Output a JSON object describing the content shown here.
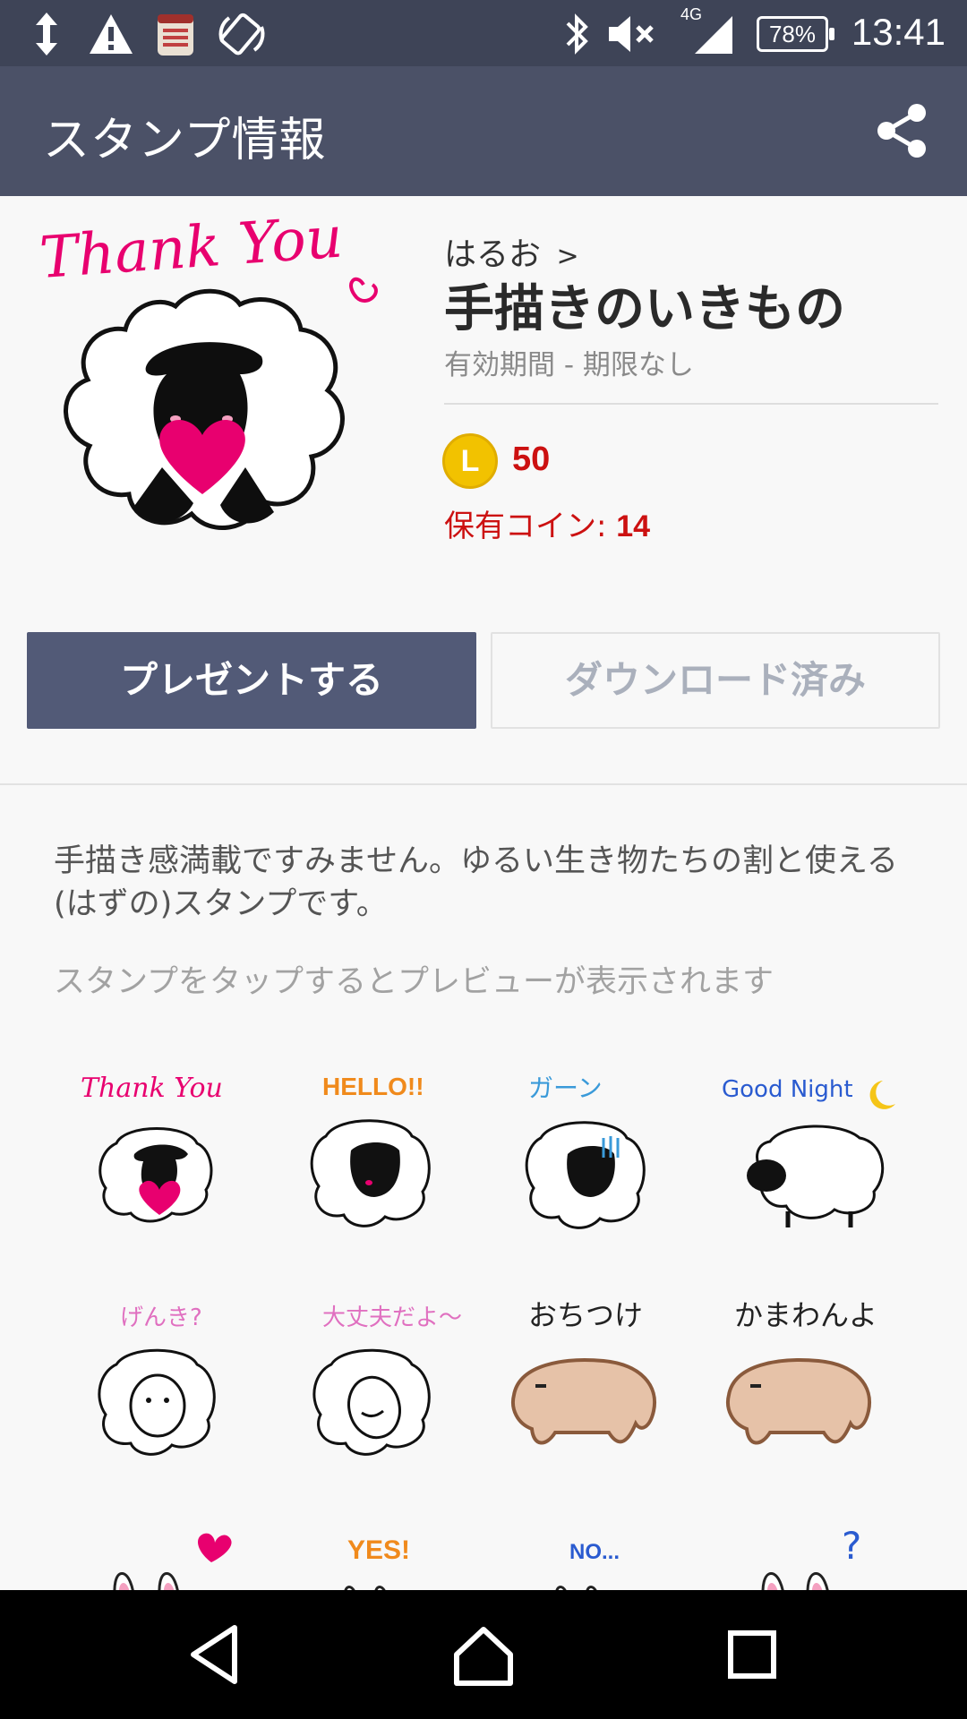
{
  "status_bar": {
    "time": "13:41",
    "battery": "78%",
    "network": "4G",
    "icons": [
      "data-transfer-icon",
      "warning-icon",
      "memo-app-icon",
      "rotation-icon",
      "bluetooth-icon",
      "mute-icon",
      "signal-icon",
      "battery-icon"
    ]
  },
  "header": {
    "title": "スタンプ情報",
    "share_icon": "share-icon"
  },
  "sticker_info": {
    "author": "はるお",
    "author_chevron": ">",
    "title": "手描きのいきもの",
    "validity": "有効期間 - 期限なし",
    "coin_icon_letter": "L",
    "price": "50",
    "owned_label": "保有コイン: ",
    "owned_value": "14"
  },
  "buttons": {
    "present": "プレゼントする",
    "download": "ダウンロード済み"
  },
  "description": "手描き感満載ですみません。ゆるい生き物たちの割と使える(はずの)スタンプです。",
  "preview_hint": "スタンプをタップするとプレビューが表示されます",
  "stickers": [
    {
      "caption": "Thank You",
      "icon": "sheep-heart-sticker"
    },
    {
      "caption": "HELLO!!",
      "icon": "sheep-hello-sticker"
    },
    {
      "caption": "ガーン",
      "icon": "sheep-shock-sticker"
    },
    {
      "caption": "Good Night",
      "icon": "sheep-sleep-sticker"
    },
    {
      "caption": "げんき?",
      "icon": "sheep-genki-sticker"
    },
    {
      "caption": "大丈夫だよ～",
      "icon": "sheep-daijoubu-sticker"
    },
    {
      "caption": "おちつけ",
      "icon": "capybara-ochitsuke-sticker"
    },
    {
      "caption": "かまわんよ",
      "icon": "capybara-kamawanyo-sticker"
    },
    {
      "caption": "",
      "icon": "rabbit-heart-sticker"
    },
    {
      "caption": "YES!",
      "icon": "rabbit-yes-sticker"
    },
    {
      "caption": "NO...",
      "icon": "rabbit-no-sticker"
    },
    {
      "caption": "?",
      "icon": "rabbit-question-sticker"
    }
  ],
  "colors": {
    "status_bar": "#3e4457",
    "header": "#4b5167",
    "present_button": "#525a77",
    "price_red": "#cc1111",
    "coin_gold": "#f2c200",
    "sticker_pink": "#e8006f"
  },
  "nav": {
    "back": "back-icon",
    "home": "home-icon",
    "recents": "recents-icon"
  }
}
